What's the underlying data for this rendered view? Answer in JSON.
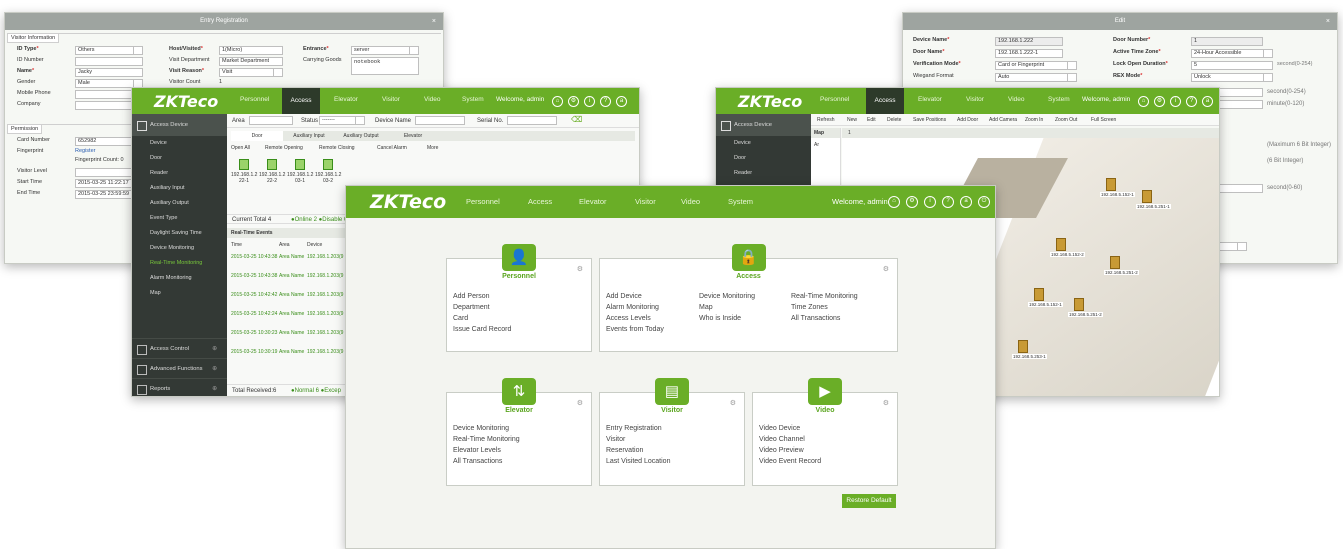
{
  "entry": {
    "title": "Entry Registration",
    "close": "×",
    "visitor_group": "Visitor Information",
    "permission_group": "Permission",
    "labels": {
      "id_type": "ID Type",
      "id_number": "ID Number",
      "name": "Name",
      "gender": "Gender",
      "mobile": "Mobile Phone",
      "company": "Company",
      "host": "Host/Visited",
      "visit_dept": "Visit Department",
      "visit_reason": "Visit Reason",
      "visitor_count": "Visitor Count",
      "entrance": "Entrance",
      "carrying": "Carrying Goods",
      "card_number": "Card Number",
      "fingerprint": "Fingerprint",
      "visitor_level": "Visitor Level",
      "start_time": "Start Time",
      "end_time": "End Time"
    },
    "values": {
      "id_type": "Others",
      "name": "Jacky",
      "gender": "Male",
      "host": "1(Micro)",
      "visit_dept": "Market Department",
      "visit_reason": "Visit",
      "visitor_count": "1",
      "entrance": "server",
      "carrying": "notebook",
      "card_number": "652982",
      "fingerprint_link": "Register",
      "fingerprint_count": "Fingerprint Count: 0",
      "start_time": "2015-03-25 11:22:17",
      "end_time": "2015-03-25 23:59:59"
    }
  },
  "header": {
    "logo": "ZKTeco",
    "nav": [
      "Personnel",
      "Access",
      "Elevator",
      "Visitor",
      "Video",
      "System"
    ],
    "welcome": "Welcome, admin"
  },
  "access": {
    "sidebar_top": "Access Device",
    "sidebar_items": [
      "Device",
      "Door",
      "Reader",
      "Auxiliary Input",
      "Auxiliary Output",
      "Event Type",
      "Daylight Saving Time",
      "Device Monitoring",
      "Real-Time Monitoring",
      "Alarm Monitoring",
      "Map"
    ],
    "sidebar_sections": [
      "Access Control",
      "Advanced Functions",
      "Reports"
    ],
    "filters": {
      "area": "Area",
      "status": "Status",
      "status_value": "-------",
      "device_name": "Device Name",
      "serial_no": "Serial No."
    },
    "tabs": [
      "Door",
      "Auxiliary Input",
      "Auxiliary Output",
      "Elevator"
    ],
    "toolbar": [
      "Open All",
      "Remote Opening",
      "Remote Closing",
      "Cancel Alarm",
      "More"
    ],
    "devices": [
      "192.168.1.2 22-1",
      "192.168.1.2 22-2",
      "192.168.1.2 03-1",
      "192.168.1.2 03-2"
    ],
    "current_total": "Current Total 4",
    "legend_top": "●Online 2 ●Disable 0",
    "events_title": "Real-Time Events",
    "events_cols": [
      "Time",
      "Area",
      "Device"
    ],
    "events": [
      {
        "time": "2015-03-25 10:43:38",
        "area": "Area Name",
        "device": "192.168.1.203(9"
      },
      {
        "time": "2015-03-25 10:43:38",
        "area": "Area Name",
        "device": "192.168.1.203(9"
      },
      {
        "time": "2015-03-25 10:42:42",
        "area": "Area Name",
        "device": "192.168.1.203(9"
      },
      {
        "time": "2015-03-25 10:42:24",
        "area": "Area Name",
        "device": "192.168.1.203(9"
      },
      {
        "time": "2015-03-25 10:30:23",
        "area": "Area Name",
        "device": "192.168.1.203(9"
      },
      {
        "time": "2015-03-25 10:30:19",
        "area": "Area Name",
        "device": "192.168.1.203(9"
      }
    ],
    "total_received": "Total Received:6",
    "legend_bottom": "●Normal 6 ●Excep"
  },
  "edit": {
    "title": "Edit",
    "labels": {
      "device_name": "Device Name",
      "door_name": "Door Name",
      "verification": "Verification Mode",
      "wiegand": "Wiegand Format",
      "door_number": "Door Number",
      "active_tz": "Active Time Zone",
      "lock_open": "Lock Open Duration",
      "rex_mode": "REX Mode"
    },
    "values": {
      "device_name": "192.168.1.222",
      "door_name": "192.168.1.222-1",
      "verification": "Card or Fingerprint",
      "wiegand": "Auto",
      "door_number": "1",
      "active_tz": "24-Hour Accessible",
      "lock_open": "5",
      "rex_mode": "Unlock"
    },
    "hints": [
      "second(0-254)",
      "second(0-254)",
      "minute(0-120)",
      "(Maximum 6 Bit Integer)",
      "(6 Bit Integer)",
      "second(0-60)"
    ]
  },
  "map": {
    "toolbar": [
      "Refresh",
      "New",
      "Edit",
      "Delete",
      "Save Positions",
      "Add Door",
      "Add Camera",
      "Zoom In",
      "Zoom Out",
      "Full Screen"
    ],
    "tree_title": "Map",
    "tree_node": "Ar",
    "canvas_label": "1",
    "doors": [
      "192.168.5.152-1",
      "192.168.5.251-1",
      "192.168.5.152-2",
      "192.168.5.251-2",
      "192.168.5.152-1",
      "192.168.5.251-2",
      "192.168.5.253-1"
    ]
  },
  "home": {
    "cards": [
      {
        "title": "Personnel",
        "icon": "person-icon",
        "links": [
          "Add Person",
          "Department",
          "Card",
          "Issue Card Record"
        ]
      },
      {
        "title": "Access",
        "icon": "lock-icon",
        "links": [
          "Add Device",
          "Alarm Monitoring",
          "Access Levels",
          "Events from Today",
          "Device Monitoring",
          "Map",
          "Who is Inside",
          "Real-Time Monitoring",
          "Time Zones",
          "All Transactions"
        ]
      },
      {
        "title": "Elevator",
        "icon": "elevator-icon",
        "links": [
          "Device Monitoring",
          "Real-Time Monitoring",
          "Elevator Levels",
          "All Transactions"
        ]
      },
      {
        "title": "Visitor",
        "icon": "visitor-card-icon",
        "links": [
          "Entry Registration",
          "Visitor",
          "Reservation",
          "Last Visited Location"
        ]
      },
      {
        "title": "Video",
        "icon": "camera-icon",
        "links": [
          "Video Device",
          "Video Channel",
          "Video Preview",
          "Video Event Record"
        ]
      }
    ],
    "restore": "Restore Default"
  },
  "colors": {
    "brand_green": "#6aae27",
    "dark_sidebar": "#333935",
    "event_green": "#3a8e1a"
  }
}
